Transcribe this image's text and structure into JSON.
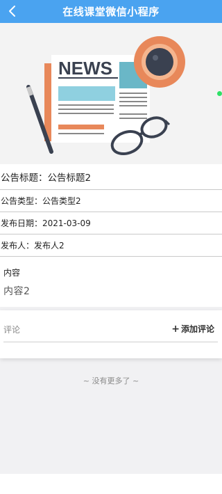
{
  "header": {
    "title": "在线课堂微信小程序",
    "back_icon": "chevron-left-icon",
    "bg_color": "#4aa3f0"
  },
  "hero": {
    "image_text": "NEWS",
    "image_description_icon": "newspaper-coffee-glasses-illustration"
  },
  "notice": {
    "title_line": "公告标题：公告标题2",
    "type_line": "公告类型：公告类型2",
    "date_line": "发布日期：2021-03-09",
    "publisher_line": "发布人：发布人2"
  },
  "content": {
    "label": "内容",
    "text": "内容2"
  },
  "comments": {
    "label": "评论",
    "add_label": "添加评论",
    "add_icon": "plus-icon"
  },
  "footer": {
    "no_more_text": "~ 没有更多了 ~"
  }
}
